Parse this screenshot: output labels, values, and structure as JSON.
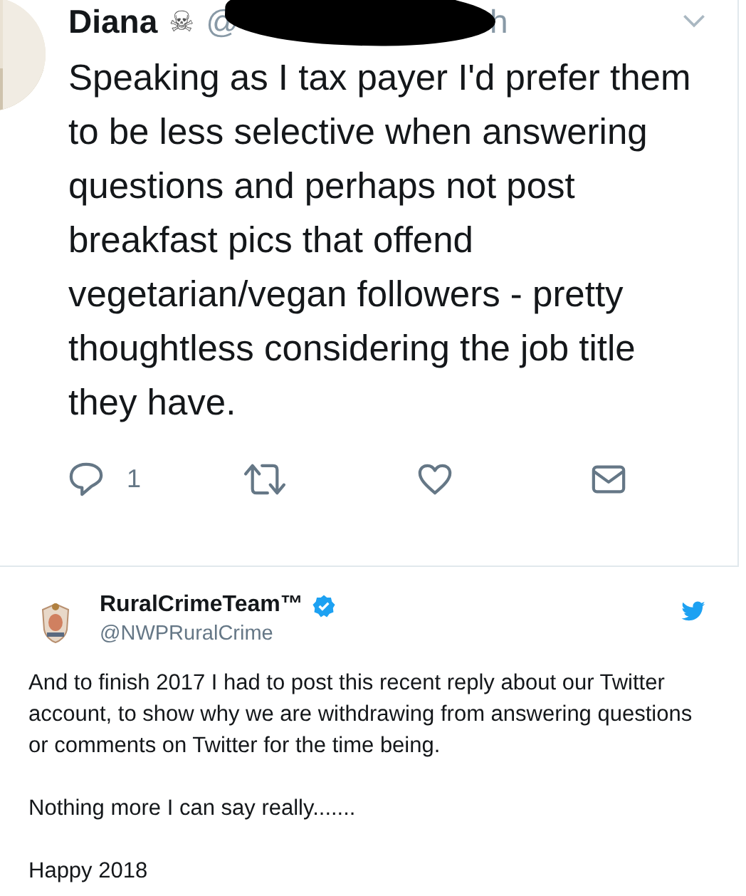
{
  "quoted_tweet": {
    "author": "Diana",
    "author_emoji": "☠",
    "handle_start": "@",
    "handle_end": "h",
    "redacted": true,
    "text": "Speaking as I tax payer I'd prefer them to be less selective when answering questions and perhaps not post breakfast pics that offend vegetarian/vegan followers - pretty thoughtless considering the job title they have.",
    "reply_count": "1"
  },
  "tweet": {
    "author": "RuralCrimeTeam™",
    "verified": true,
    "handle": "@NWPRuralCrime",
    "paragraphs": [
      "And to finish 2017 I had to post this recent reply about our Twitter account, to show why we are withdrawing from answering questions or comments on Twitter for the time being.",
      "Nothing more I can say really.......",
      "Happy 2018"
    ]
  }
}
